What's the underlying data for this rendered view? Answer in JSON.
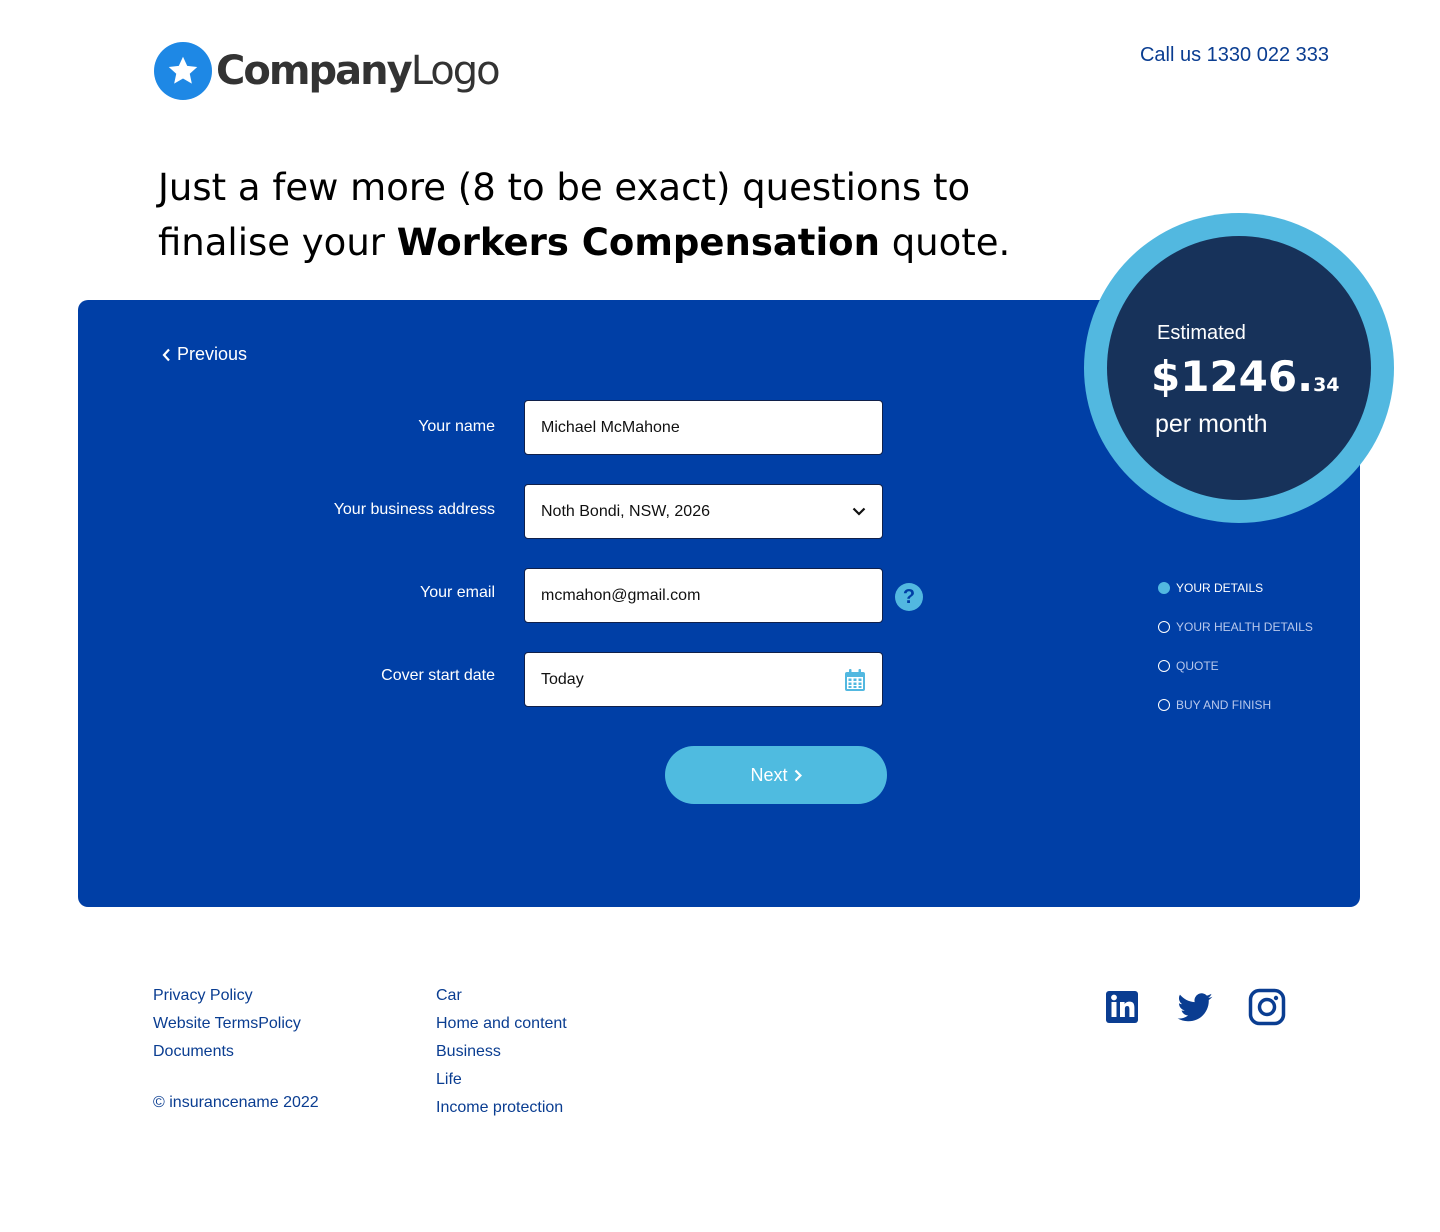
{
  "header": {
    "logo_main": "Company",
    "logo_thin": "Logo",
    "call_us": "Call us 1330 022 333"
  },
  "headline": {
    "part1": "Just a few more (8 to be exact) questions to finalise your ",
    "bold": "Workers Compensation",
    "part2": " quote."
  },
  "form": {
    "previous_label": "Previous",
    "name_label": "Your name",
    "name_value": "Michael McMahone",
    "address_label": "Your business address",
    "address_value": "Noth Bondi, NSW, 2026",
    "email_label": "Your email",
    "email_value": "mcmahon@gmail.com",
    "help_glyph": "?",
    "start_label": "Cover start date",
    "start_value": "Today",
    "next_label": "Next"
  },
  "estimate": {
    "label": "Estimated",
    "amount": "$1246.",
    "cents": "34",
    "period": "per month"
  },
  "steps": [
    {
      "label": "YOUR DETAILS",
      "active": true
    },
    {
      "label": "YOUR HEALTH DETAILS",
      "active": false
    },
    {
      "label": "QUOTE",
      "active": false
    },
    {
      "label": "BUY AND FINISH",
      "active": false
    }
  ],
  "footer": {
    "col1": [
      "Privacy Policy",
      "Website TermsPolicy",
      "Documents"
    ],
    "col2": [
      "Car",
      "Home and content",
      "Business",
      "Life",
      "Income protection"
    ],
    "copyright": "© insurancename 2022"
  },
  "colors": {
    "panel": "#003fa6",
    "accent": "#4fbbe0",
    "estimate_inner": "#17325a",
    "link": "#0a3d91"
  },
  "icons": [
    "star-icon",
    "chevron-left-icon",
    "chevron-down-icon",
    "help-icon",
    "calendar-icon",
    "chevron-right-icon",
    "linkedin-icon",
    "twitter-icon",
    "instagram-icon"
  ]
}
